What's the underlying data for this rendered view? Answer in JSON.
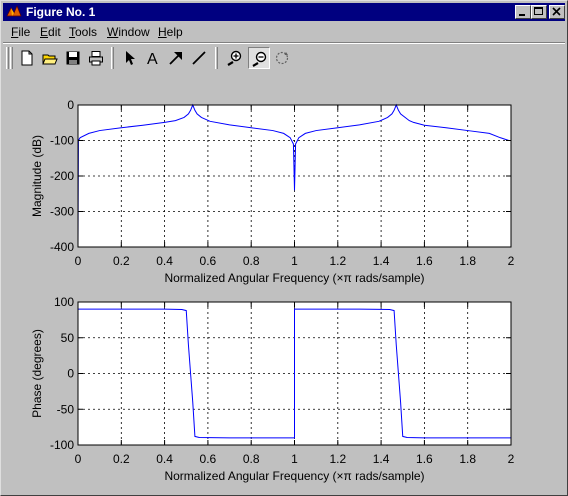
{
  "window": {
    "title": "Figure No. 1"
  },
  "menu": {
    "items": [
      {
        "label": "File",
        "mnemonic": "F",
        "rest": "ile"
      },
      {
        "label": "Edit",
        "mnemonic": "E",
        "rest": "dit"
      },
      {
        "label": "Tools",
        "mnemonic": "T",
        "rest": "ools"
      },
      {
        "label": "Window",
        "mnemonic": "W",
        "rest": "indow"
      },
      {
        "label": "Help",
        "mnemonic": "H",
        "rest": "elp"
      }
    ]
  },
  "toolbar": {
    "tools": [
      "new-file-icon",
      "open-folder-icon",
      "save-icon",
      "print-icon",
      "arrow-select-icon",
      "text-insert-icon",
      "arrow-insert-icon",
      "line-insert-icon",
      "zoom-in-icon",
      "zoom-out-icon",
      "rotate-3d-icon"
    ],
    "text_tool_glyph": "A"
  },
  "colors": {
    "curve": "#0000ff",
    "titlebar": "#000080",
    "face": "#c0c0c0"
  },
  "chart_data": [
    {
      "type": "line",
      "title": "",
      "xlabel": "Normalized Angular Frequency  (×π rads/sample)",
      "ylabel": "Magnitude (dB)",
      "xlim": [
        0,
        2
      ],
      "ylim": [
        -400,
        0
      ],
      "xticks": [
        0,
        0.2,
        0.4,
        0.6,
        0.8,
        1,
        1.2,
        1.4,
        1.6,
        1.8,
        2
      ],
      "xtick_labels": [
        "0",
        "0.2",
        "0.4",
        "0.6",
        "0.8",
        "1",
        "1.2",
        "1.4",
        "1.6",
        "1.8",
        "2"
      ],
      "yticks": [
        0,
        -100,
        -200,
        -300,
        -400
      ],
      "ytick_labels": [
        "0",
        "-100",
        "-200",
        "-300",
        "-400"
      ],
      "grid": true,
      "series": [
        {
          "x": [
            0,
            0.002,
            0.01,
            0.05,
            0.1,
            0.2,
            0.3,
            0.4,
            0.45,
            0.49,
            0.51,
            0.52,
            0.53,
            0.54,
            0.55,
            0.57,
            0.61,
            0.7,
            0.8,
            0.9,
            0.95,
            0.98,
            0.995,
            1.0,
            1.005,
            1.02,
            1.05,
            1.1,
            1.2,
            1.3,
            1.39,
            1.43,
            1.45,
            1.46,
            1.47,
            1.48,
            1.49,
            1.53,
            1.55,
            1.6,
            1.7,
            1.8,
            1.9,
            1.95,
            1.99,
            2.0
          ],
          "y": [
            -400,
            -100,
            -92,
            -80,
            -72,
            -64,
            -57,
            -49,
            -44,
            -35,
            -25,
            -15,
            0,
            -15,
            -25,
            -35,
            -46,
            -56,
            -64,
            -72,
            -80,
            -92,
            -110,
            -240,
            -110,
            -92,
            -80,
            -72,
            -64,
            -56,
            -46,
            -35,
            -25,
            -15,
            0,
            -15,
            -25,
            -44,
            -49,
            -57,
            -64,
            -72,
            -80,
            -92,
            -100,
            -100
          ]
        }
      ]
    },
    {
      "type": "line",
      "title": "",
      "xlabel": "Normalized Angular Frequency  (×π rads/sample)",
      "ylabel": "Phase (degrees)",
      "xlim": [
        0,
        2
      ],
      "ylim": [
        -100,
        100
      ],
      "xticks": [
        0,
        0.2,
        0.4,
        0.6,
        0.8,
        1,
        1.2,
        1.4,
        1.6,
        1.8,
        2
      ],
      "xtick_labels": [
        "0",
        "0.2",
        "0.4",
        "0.6",
        "0.8",
        "1",
        "1.2",
        "1.4",
        "1.6",
        "1.8",
        "2"
      ],
      "yticks": [
        100,
        50,
        0,
        -50,
        -100
      ],
      "ytick_labels": [
        "100",
        "50",
        "0",
        "-50",
        "-100"
      ],
      "grid": true,
      "series": [
        {
          "x": [
            0,
            0.4,
            0.48,
            0.5,
            0.51,
            0.52,
            0.53,
            0.54,
            0.56,
            0.7,
            0.999,
            1.0,
            1.0,
            1.001,
            1.3,
            1.44,
            1.46,
            1.47,
            1.48,
            1.49,
            1.5,
            1.52,
            1.6,
            2.0
          ],
          "y": [
            90,
            90,
            89.5,
            88,
            40,
            0,
            -40,
            -88,
            -89.5,
            -90,
            -90,
            -90,
            90,
            90,
            90,
            89.5,
            88,
            40,
            0,
            -40,
            -88,
            -89.5,
            -90,
            -90
          ]
        }
      ]
    }
  ]
}
